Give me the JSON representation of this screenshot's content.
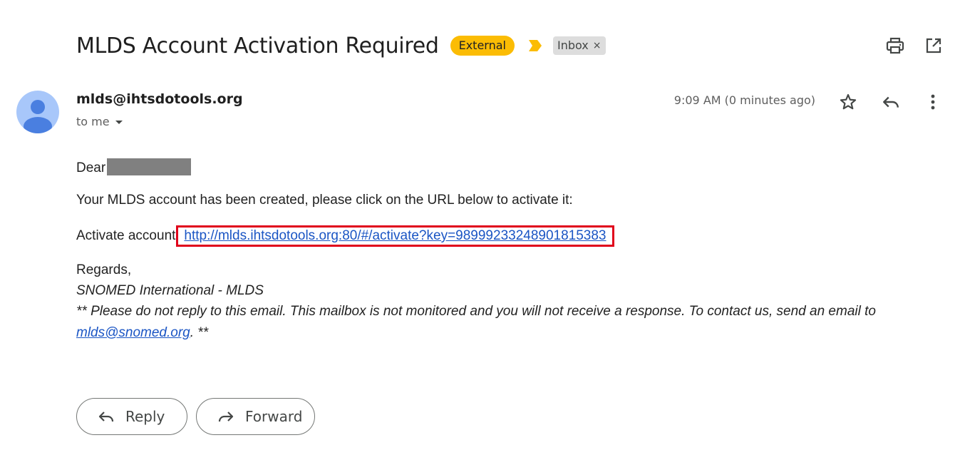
{
  "header": {
    "subject": "MLDS Account Activation Required",
    "external_label": "External",
    "inbox_label": "Inbox",
    "inbox_remove": "×",
    "icons": [
      "importance-marker-icon",
      "print-icon",
      "open-in-new-window-icon"
    ]
  },
  "message": {
    "sender_email": "mlds@ihtsdotools.org",
    "recipient_label": "to me",
    "timestamp": "9:09 AM (0 minutes ago)",
    "icons": [
      "star-icon",
      "reply-icon",
      "more-vert-icon"
    ]
  },
  "body": {
    "greeting": "Dear",
    "intro": "Your MLDS account has been created, please click on the URL below to activate it:",
    "activate_label": "Activate account",
    "activate_url": "http://mlds.ihtsdotools.org:80/#/activate?key=98999233248901815383",
    "regards": "Regards,",
    "signature": "SNOMED International - MLDS",
    "disclaimer": "** Please do not reply to this email. This mailbox is not monitored and you will not receive a response. To contact us, send an email to",
    "contact_email": "mlds@snomed.org",
    "disclaimer_end": ". **"
  },
  "actions": {
    "reply_label": "Reply",
    "forward_label": "Forward"
  },
  "colors": {
    "external_badge": "#fbbc04",
    "importance": "#fbbc04",
    "link": "#1a55c4",
    "highlight_box": "#e0001b",
    "avatar_bg": "#a8c7fa",
    "avatar_fg": "#4a7fe0"
  }
}
